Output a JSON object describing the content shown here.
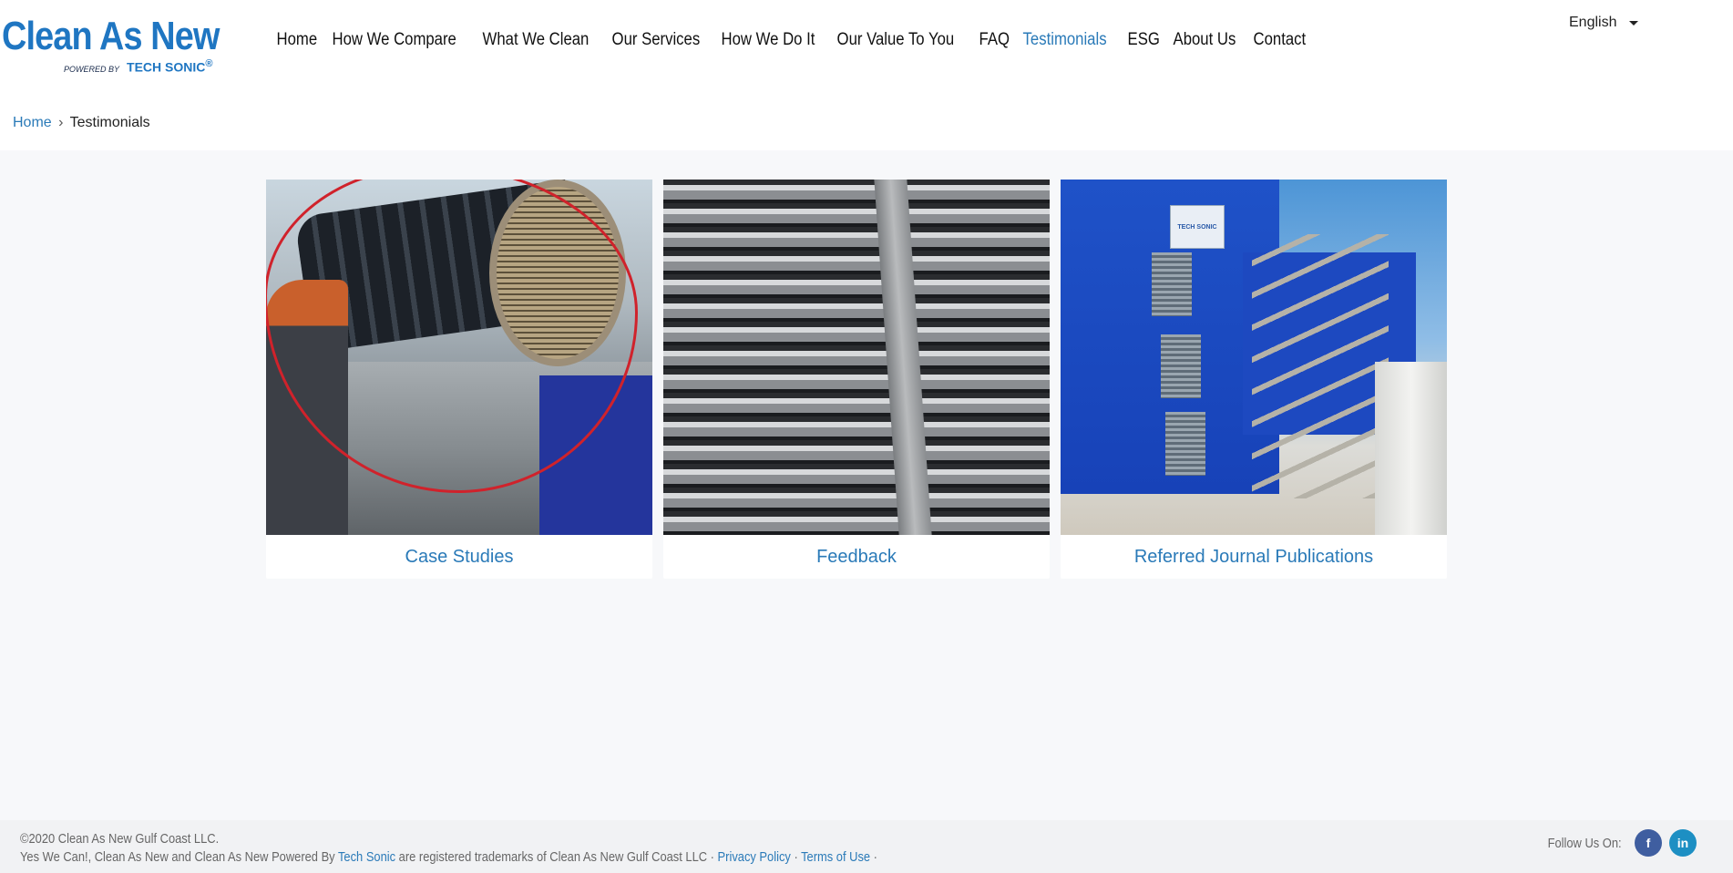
{
  "brand": {
    "logo_main": "Clean As New",
    "powered_by": "POWERED BY",
    "tech": "TECH SONIC",
    "reg": "®"
  },
  "nav": {
    "items": [
      {
        "label": "Home"
      },
      {
        "label": "How We Compare"
      },
      {
        "label": "What We Clean"
      },
      {
        "label": "Our Services"
      },
      {
        "label": "How We Do It"
      },
      {
        "label": "Our Value To You"
      },
      {
        "label": "FAQ"
      },
      {
        "label": "Testimonials",
        "active": true
      },
      {
        "label": "ESG"
      },
      {
        "label": "About Us"
      },
      {
        "label": "Contact"
      }
    ]
  },
  "language": {
    "selected": "English"
  },
  "breadcrumb": {
    "home": "Home",
    "separator": "›",
    "current": "Testimonials"
  },
  "cards": [
    {
      "label": "Case Studies"
    },
    {
      "label": "Feedback"
    },
    {
      "label": "Referred Journal Publications"
    }
  ],
  "image_text": {
    "sign": "TECH SONIC"
  },
  "footer": {
    "copyright": "©2020 Clean As New Gulf Coast LLC.",
    "legal_prefix": "Yes We Can!, Clean As New and Clean As New Powered By",
    "legal_link": "Tech Sonic",
    "legal_suffix": "are registered trademarks of Clean As New Gulf Coast LLC ·",
    "privacy": "Privacy Policy",
    "dot": "·",
    "terms": "Terms of Use",
    "dot_end": "·",
    "follow": "Follow Us On:",
    "facebook": "f",
    "linkedin": "in"
  },
  "colors": {
    "accent": "#2a7ab8",
    "logo": "#1f76c2",
    "annotation": "#d0222b"
  }
}
